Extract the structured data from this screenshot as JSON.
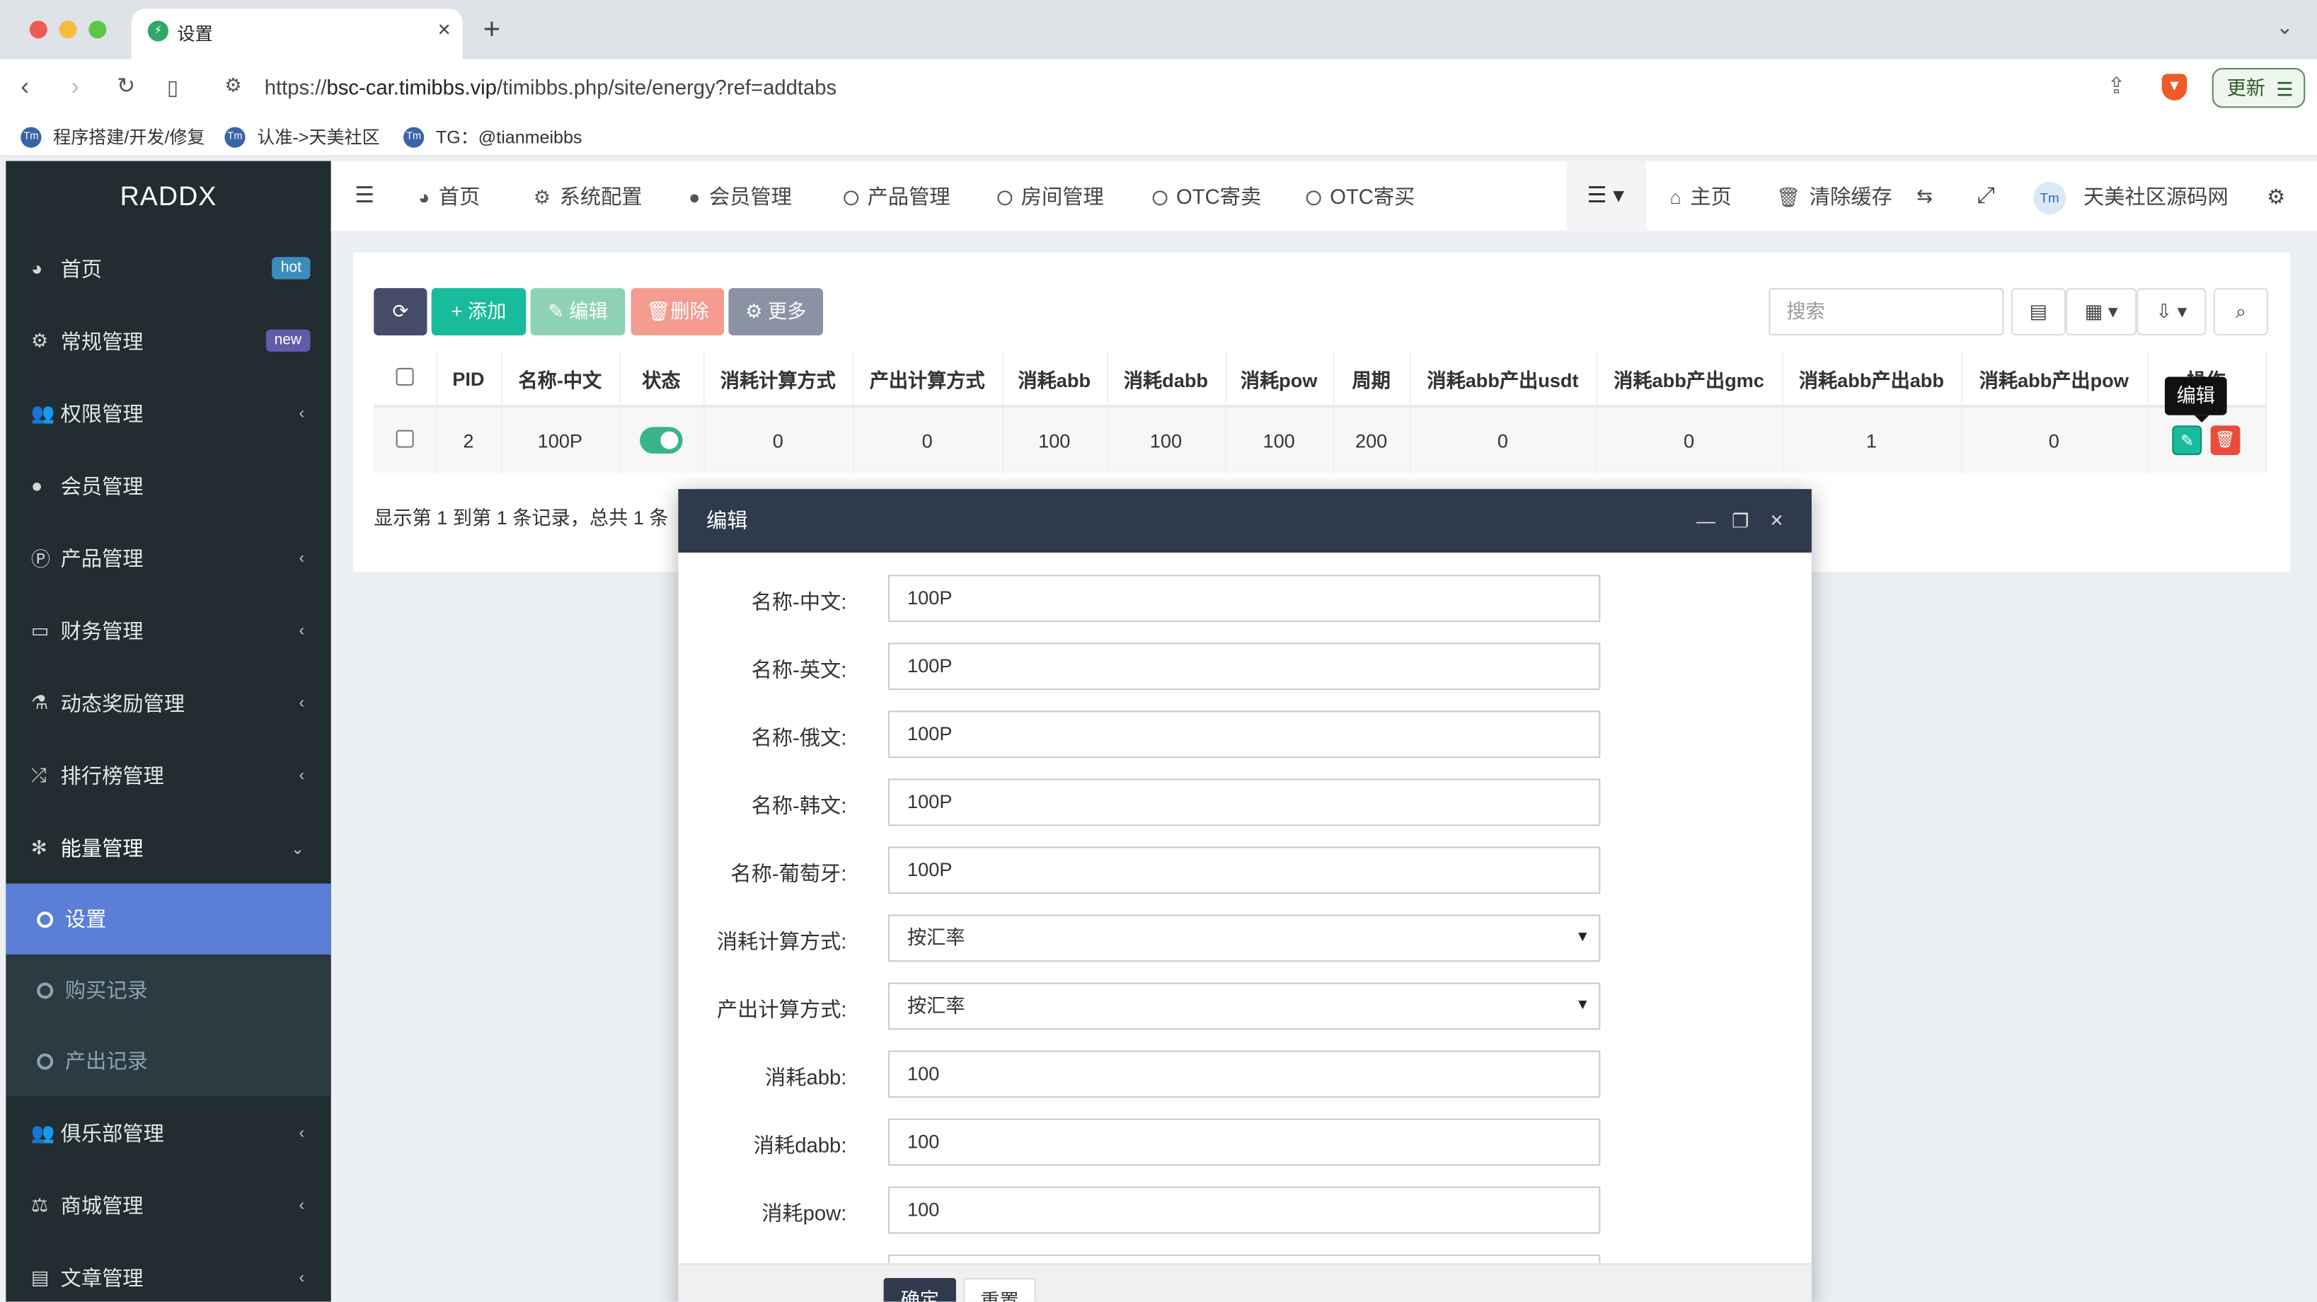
{
  "browser": {
    "tab_title": "设置",
    "url_prefix": "https://",
    "url_host": "bsc-car.timibbs.vip",
    "url_path": "/timibbs.php/site/energy?ref=addtabs",
    "update_label": "更新",
    "bookmarks": [
      "程序搭建/开发/修复",
      "认准->天美社区",
      "TG：@tianmeibbs"
    ]
  },
  "sidebar": {
    "logo": "RADDX",
    "items": [
      {
        "label": "首页",
        "icon": "dashboard-icon",
        "badge": "hot",
        "badge_color": "#3c8dbc"
      },
      {
        "label": "常规管理",
        "icon": "cogs-icon",
        "badge": "new",
        "badge_color": "#605ca8"
      },
      {
        "label": "权限管理",
        "icon": "users-icon"
      },
      {
        "label": "会员管理",
        "icon": "user-icon"
      },
      {
        "label": "产品管理",
        "icon": "product-icon"
      },
      {
        "label": "财务管理",
        "icon": "credit-card-icon"
      },
      {
        "label": "动态奖励管理",
        "icon": "flask-icon"
      },
      {
        "label": "排行榜管理",
        "icon": "random-icon"
      },
      {
        "label": "能量管理",
        "icon": "energy-icon"
      }
    ],
    "sub_items": [
      "设置",
      "购买记录",
      "产出记录"
    ],
    "items_after": [
      {
        "label": "俱乐部管理",
        "icon": "group-icon"
      },
      {
        "label": "商城管理",
        "icon": "balance-icon"
      },
      {
        "label": "文章管理",
        "icon": "newspaper-icon"
      }
    ]
  },
  "topnav": {
    "items": [
      "首页",
      "系统配置",
      "会员管理",
      "产品管理",
      "房间管理",
      "OTC寄卖",
      "OTC寄买"
    ],
    "right": {
      "home": "主页",
      "clear_cache": "清除缓存",
      "site_name": "天美社区源码网"
    }
  },
  "toolbar": {
    "add": "添加",
    "edit": "编辑",
    "delete": "删除",
    "more": "更多",
    "search_placeholder": "搜索"
  },
  "table": {
    "headers": [
      "PID",
      "名称-中文",
      "状态",
      "消耗计算方式",
      "产出计算方式",
      "消耗abb",
      "消耗dabb",
      "消耗pow",
      "周期",
      "消耗abb产出usdt",
      "消耗abb产出gmc",
      "消耗abb产出abb",
      "消耗abb产出pow",
      "操作"
    ],
    "rows": [
      {
        "pid": "2",
        "name": "100P",
        "status": true,
        "consume_method": "0",
        "output_method": "0",
        "abb": "100",
        "dabb": "100",
        "pow": "100",
        "period": "200",
        "usdt": "0",
        "gmc": "0",
        "out_abb": "1",
        "out_pow": "0"
      }
    ],
    "tooltip": "编辑",
    "summary": "显示第 1 到第 1 条记录，总共 1 条"
  },
  "modal": {
    "title": "编辑",
    "fields": [
      {
        "label": "名称-中文:",
        "value": "100P"
      },
      {
        "label": "名称-英文:",
        "value": "100P"
      },
      {
        "label": "名称-俄文:",
        "value": "100P"
      },
      {
        "label": "名称-韩文:",
        "value": "100P"
      },
      {
        "label": "名称-葡萄牙:",
        "value": "100P"
      },
      {
        "label": "消耗计算方式:",
        "value": "按汇率",
        "select": true
      },
      {
        "label": "产出计算方式:",
        "value": "按汇率",
        "select": true
      },
      {
        "label": "消耗abb:",
        "value": "100"
      },
      {
        "label": "消耗dabb:",
        "value": "100"
      },
      {
        "label": "消耗pow:",
        "value": "100"
      }
    ],
    "confirm": "确定",
    "reset": "重置"
  },
  "colors": {
    "sidebar_bg": "#222d32",
    "active_sub": "#5b7ed6",
    "refresh_btn": "#444c69",
    "add_btn": "#18bc9c",
    "edit_btn": "#8ed2b6",
    "delete_btn": "#f39c8f",
    "more_btn": "#8b92a3",
    "modal_header": "#2f3a4c"
  }
}
